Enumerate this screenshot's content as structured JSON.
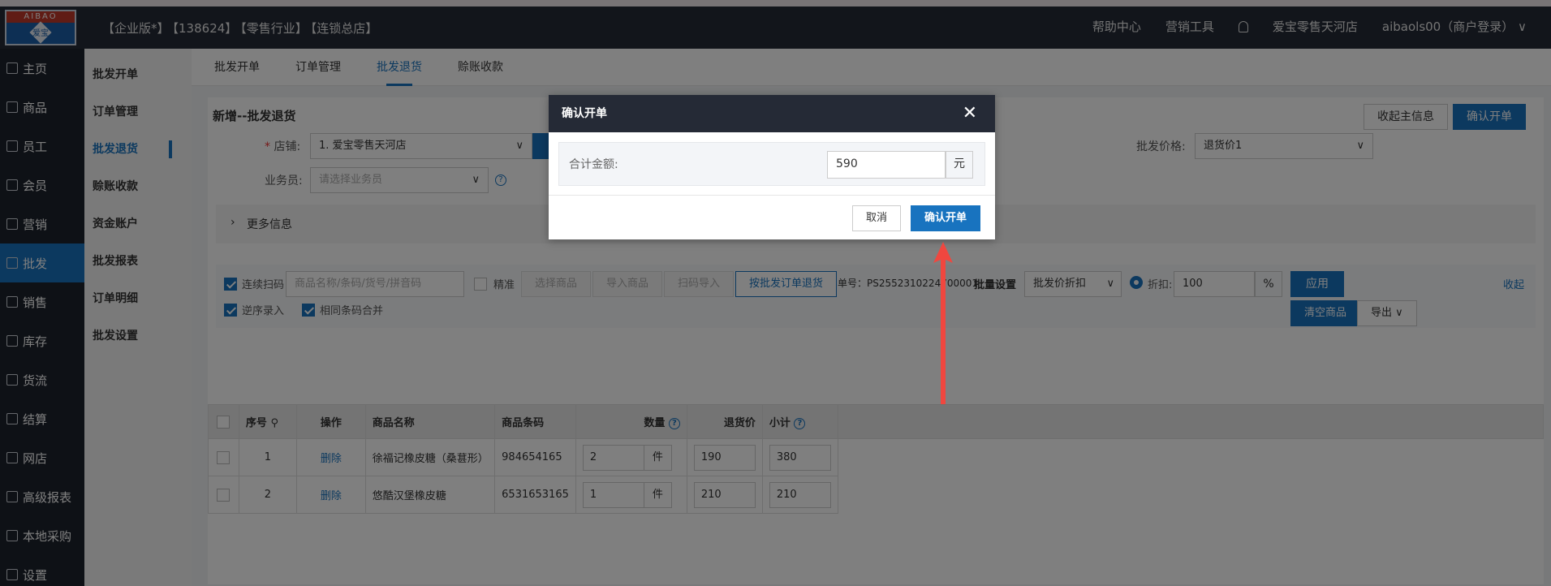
{
  "header": {
    "tags": [
      "【企业版*】",
      "【138624】",
      "【零售行业】",
      "【连锁总店】"
    ],
    "logo_top": "AIBAO",
    "logo_text": "爱宝",
    "help": "帮助中心",
    "marketing": "营销工具",
    "store": "爱宝零售天河店",
    "user": "aibaols00（商户登录）"
  },
  "sidebar": {
    "items": [
      {
        "label": "主页"
      },
      {
        "label": "商品"
      },
      {
        "label": "员工"
      },
      {
        "label": "会员"
      },
      {
        "label": "营销"
      },
      {
        "label": "批发"
      },
      {
        "label": "销售"
      },
      {
        "label": "库存"
      },
      {
        "label": "货流"
      },
      {
        "label": "结算"
      },
      {
        "label": "网店"
      },
      {
        "label": "高级报表"
      },
      {
        "label": "本地采购"
      },
      {
        "label": "设置"
      }
    ],
    "active": "批发"
  },
  "submenu": {
    "items": [
      {
        "label": "批发开单"
      },
      {
        "label": "订单管理"
      },
      {
        "label": "批发退货"
      },
      {
        "label": "赊账收款"
      },
      {
        "label": "资金账户"
      },
      {
        "label": "批发报表"
      },
      {
        "label": "订单明细"
      },
      {
        "label": "批发设置"
      }
    ]
  },
  "tabs": [
    {
      "label": "批发开单"
    },
    {
      "label": "订单管理"
    },
    {
      "label": "批发退货"
    },
    {
      "label": "赊账收款"
    }
  ],
  "form": {
    "title": "新增--批发退货",
    "collapse_btn": "收起主信息",
    "confirm_btn": "确认开单",
    "store_label": "店铺:",
    "store_value": "1. 爱宝零售天河店",
    "staff_label": "业务员:",
    "staff_placeholder": "请选择业务员",
    "price_label": "批发价格:",
    "price_value": "退货价1",
    "more_info": "更多信息"
  },
  "toolbar": {
    "continuous_scan": "连续扫码",
    "search_placeholder": "商品名称/条码/货号/拼音码",
    "exact": "精准",
    "select_goods": "选择商品",
    "import_goods": "导入商品",
    "scan_import": "扫码导入",
    "by_order_return": "按批发订单退货",
    "order_no": "单号：PS2552310224700001",
    "batch_set": "批量设置",
    "batch_option": "批发价折扣",
    "discount_label": "折扣:",
    "discount_value": "100",
    "percent": "%",
    "apply": "应用",
    "collapse": "收起",
    "reverse_entry": "逆序录入",
    "merge_same": "相同条码合并",
    "clear_goods": "清空商品",
    "export": "导出"
  },
  "table": {
    "headers": [
      "序号",
      "操作",
      "商品名称",
      "商品条码",
      "数量",
      "退货价",
      "小计"
    ],
    "rows": [
      {
        "no": "1",
        "op": "删除",
        "name": "徐福记橡皮糖（桑葚形）",
        "barcode": "984654165",
        "qty": "2",
        "unit": "件",
        "price": "190",
        "subtotal": "380"
      },
      {
        "no": "2",
        "op": "删除",
        "name": "悠酷汉堡橡皮糖",
        "barcode": "6531653165",
        "qty": "1",
        "unit": "件",
        "price": "210",
        "subtotal": "210"
      }
    ]
  },
  "modal": {
    "title": "确认开单",
    "total_label": "合计金额:",
    "total_value": "590",
    "currency": "元",
    "cancel": "取消",
    "confirm": "确认开单"
  },
  "colors": {
    "header_bg": "#252a36",
    "sidebar_bg": "#1d222d",
    "accent": "#1873bf",
    "arrow": "#f0473f"
  }
}
